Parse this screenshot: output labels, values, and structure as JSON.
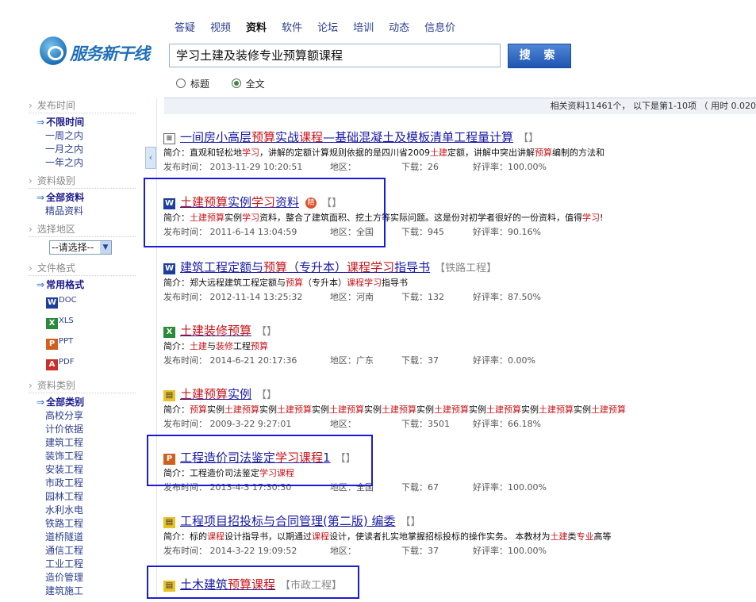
{
  "site": {
    "logo_text": "服务新干线"
  },
  "nav": [
    "答疑",
    "视频",
    "资料",
    "软件",
    "论坛",
    "培训",
    "动态",
    "信息价"
  ],
  "nav_active": 2,
  "search": {
    "value": "学习土建及装修专业预算额课程",
    "button": "搜 索"
  },
  "search_scope": {
    "title_label": "标题",
    "fulltext_label": "全文",
    "selected": "全文"
  },
  "results_bar": "相关资料11461个， 以下是第1-10项 （ 用时 0.020",
  "sidebar": {
    "time": {
      "title": "发布时间",
      "items": [
        "不限时间",
        "一周之内",
        "一月之内",
        "一年之内"
      ],
      "selected": 0
    },
    "level": {
      "title": "资料级别",
      "items": [
        "全部资料",
        "精品资料"
      ],
      "selected": 0
    },
    "region": {
      "title": "选择地区",
      "select_value": "--请选择--"
    },
    "format": {
      "title": "文件格式",
      "items": [
        "常用格式"
      ],
      "selected": 0,
      "types": [
        {
          "label": "DOC",
          "icon": "word-icon"
        },
        {
          "label": "XLS",
          "icon": "excel-icon"
        },
        {
          "label": "PPT",
          "icon": "powerpoint-icon"
        },
        {
          "label": "PDF",
          "icon": "pdf-icon"
        }
      ]
    },
    "category": {
      "title": "资料类别",
      "items": [
        "全部类别",
        "高校分享",
        "计价依据",
        "建筑工程",
        "装饰工程",
        "安装工程",
        "市政工程",
        "园林工程",
        "水利水电",
        "铁路工程",
        "道桥隧道",
        "通信工程",
        "工业工程",
        "造价管理",
        "建筑施工"
      ],
      "selected": 0
    }
  },
  "results": [
    {
      "icon": "page-icon",
      "hot": false,
      "title": [
        [
          "一间房小高层",
          0
        ],
        [
          "预算",
          1
        ],
        [
          "实战",
          0
        ],
        [
          "课程",
          1
        ],
        [
          "—基础混凝土及模板清单工程量计算",
          0
        ]
      ],
      "tag": "【】",
      "summary": [
        [
          "简介：直观和轻松地",
          0
        ],
        [
          "学习",
          1
        ],
        [
          "，讲解的定额计算规则依据的是四川省2009",
          0
        ],
        [
          "土建",
          1
        ],
        [
          "定额，讲解中突出讲解",
          0
        ],
        [
          "预算",
          1
        ],
        [
          "编制的方法和",
          0
        ]
      ],
      "date": "发布时间： 2013-11-29 10:20:51",
      "region": "地区：",
      "downloads": "下载：26",
      "rating": "好评率：100.00%"
    },
    {
      "icon": "word-icon",
      "hot": true,
      "hot_label": "精",
      "title": [
        [
          "土建预算",
          1
        ],
        [
          "实例",
          0
        ],
        [
          "学习",
          1
        ],
        [
          "资料",
          0
        ]
      ],
      "tag": "【】",
      "summary": [
        [
          "简介：",
          0
        ],
        [
          "土建预算",
          1
        ],
        [
          "实例",
          0
        ],
        [
          "学习",
          1
        ],
        [
          "资料，整合了建筑面积、挖土方等实际问题。这是份对初学者很好的一份资料，值得",
          0
        ],
        [
          "学习",
          1
        ],
        [
          "!",
          0
        ]
      ],
      "date": "发布时间： 2011-6-14 13:04:59",
      "region": "地区：全国",
      "downloads": "下载：945",
      "rating": "好评率：90.16%"
    },
    {
      "icon": "word-icon",
      "hot": false,
      "title": [
        [
          "建筑工程定额与",
          0
        ],
        [
          "预算",
          1
        ],
        [
          "（专升本）",
          0
        ],
        [
          "课程",
          1
        ],
        [
          "学习",
          1
        ],
        [
          "指导书",
          0
        ]
      ],
      "tag": "【铁路工程】",
      "summary": [
        [
          "简介：郑大远程建筑工程定额与",
          0
        ],
        [
          "预算",
          1
        ],
        [
          "（专升本）",
          0
        ],
        [
          "课程学习",
          1
        ],
        [
          "指导书",
          0
        ]
      ],
      "date": "发布时间： 2012-11-14 13:25:32",
      "region": "地区：河南",
      "downloads": "下载：132",
      "rating": "好评率：87.50%"
    },
    {
      "icon": "excel-icon",
      "hot": false,
      "title": [
        [
          "土建装修预算",
          1
        ]
      ],
      "tag": "【】",
      "summary": [
        [
          "简介：",
          0
        ],
        [
          "土建",
          1
        ],
        [
          "与",
          0
        ],
        [
          "装修",
          1
        ],
        [
          "工程",
          0
        ],
        [
          "预算",
          1
        ]
      ],
      "date": "发布时间： 2014-6-21 20:17:36",
      "region": "地区：广东",
      "downloads": "下载：37",
      "rating": "好评率：0.00%"
    },
    {
      "icon": "archive-icon",
      "hot": false,
      "title": [
        [
          "土建预算",
          1
        ],
        [
          "实例",
          0
        ]
      ],
      "tag": "【】",
      "summary": [
        [
          "简介：",
          0
        ],
        [
          "预算",
          1
        ],
        [
          "实例",
          0
        ],
        [
          "土建预算",
          1
        ],
        [
          "实例",
          0
        ],
        [
          "土建预算",
          1
        ],
        [
          "实例",
          0
        ],
        [
          "土建预算",
          1
        ],
        [
          "实例",
          0
        ],
        [
          "土建预算",
          1
        ],
        [
          "实例",
          0
        ],
        [
          "土建预算",
          1
        ],
        [
          "实例",
          0
        ],
        [
          "土建预算",
          1
        ],
        [
          "实例",
          0
        ],
        [
          "土建预算",
          1
        ],
        [
          "实例",
          0
        ],
        [
          "土建预算",
          1
        ]
      ],
      "date": "发布时间： 2009-3-22 9:27:01",
      "region": "地区：",
      "downloads": "下载：3501",
      "rating": "好评率：66.18%"
    },
    {
      "icon": "powerpoint-icon",
      "hot": false,
      "title": [
        [
          "工程造价司法鉴定",
          0
        ],
        [
          "学习",
          1
        ],
        [
          "课程",
          1
        ],
        [
          "1",
          0
        ]
      ],
      "tag": "【】",
      "summary": [
        [
          "简介：工程造价司法鉴定",
          0
        ],
        [
          "学习课程",
          1
        ]
      ],
      "date": "发布时间： 2013-4-3 17:30:30",
      "region": "地区：全国",
      "downloads": "下载：67",
      "rating": "好评率：100.00%"
    },
    {
      "icon": "archive-icon",
      "hot": false,
      "title": [
        [
          "工程项目招投标与合同管理(第二版) 编委",
          0
        ]
      ],
      "tag": "【】",
      "summary": [
        [
          "简介：标的",
          0
        ],
        [
          "课程",
          1
        ],
        [
          "设计指导书，以期通过",
          0
        ],
        [
          "课程",
          1
        ],
        [
          "设计，使读者扎实地掌握招标投标的操作实务。  本教材为",
          0
        ],
        [
          "土建",
          1
        ],
        [
          "类",
          0
        ],
        [
          "专业",
          1
        ],
        [
          "高等",
          0
        ]
      ],
      "date": "发布时间： 2014-3-22 19:09:52",
      "region": "地区：",
      "downloads": "下载：37",
      "rating": "好评率：100.00%"
    },
    {
      "icon": "archive-icon",
      "hot": false,
      "title": [
        [
          "土木建筑",
          0
        ],
        [
          "预算",
          1
        ],
        [
          "课程",
          1
        ]
      ],
      "tag": "【市政工程】",
      "summary": [],
      "date": "",
      "region": "",
      "downloads": "",
      "rating": ""
    }
  ],
  "colors": {
    "highlight": "#c8141b",
    "link": "#1a1aa6",
    "annotation_box": "#1b1bd6"
  }
}
